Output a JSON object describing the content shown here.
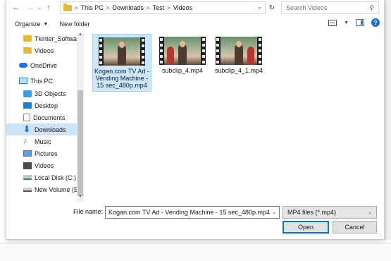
{
  "address_bar": {
    "back": "←",
    "forward": "→",
    "recent": "⌄",
    "up": "↑",
    "crumbs": [
      "This PC",
      "Downloads",
      "Test",
      "Videos"
    ],
    "search_placeholder": "Search Videos"
  },
  "toolbar": {
    "organize_label": "Organize",
    "new_folder_label": "New folder"
  },
  "nav_pane": {
    "items": [
      {
        "label": "Tkinter_Software",
        "icon": "folder-icon"
      },
      {
        "label": "Videos",
        "icon": "folder-icon"
      },
      {
        "label": "OneDrive",
        "icon": "cloud-icon"
      },
      {
        "label": "This PC",
        "icon": "computer-icon"
      },
      {
        "label": "3D Objects",
        "icon": "cube-icon"
      },
      {
        "label": "Desktop",
        "icon": "desktop-icon"
      },
      {
        "label": "Documents",
        "icon": "document-icon"
      },
      {
        "label": "Downloads",
        "icon": "download-arrow-icon",
        "selected": true
      },
      {
        "label": "Music",
        "icon": "music-note-icon"
      },
      {
        "label": "Pictures",
        "icon": "picture-icon"
      },
      {
        "label": "Videos",
        "icon": "video-icon"
      },
      {
        "label": "Local Disk (C:)",
        "icon": "local-disk-icon"
      },
      {
        "label": "New Volume (E:)",
        "icon": "drive-icon"
      }
    ]
  },
  "files": [
    {
      "name": "Kogan.com TV Ad - Vending Machine - 15 sec_480p.mp4",
      "selected": true
    },
    {
      "name": "subclip_4.mp4",
      "selected": false
    },
    {
      "name": "subclip_4_1.mp4",
      "selected": false
    }
  ],
  "file_name": {
    "label": "File name:",
    "value": "Kogan.com TV Ad - Vending Machine - 15 sec_480p.mp4"
  },
  "file_type": {
    "value": "MP4 files (*.mp4)"
  },
  "buttons": {
    "open": "Open",
    "cancel": "Cancel"
  },
  "colors": {
    "selection": "#cce8ff",
    "accent": "#0078d7",
    "folder": "#e8b931"
  }
}
